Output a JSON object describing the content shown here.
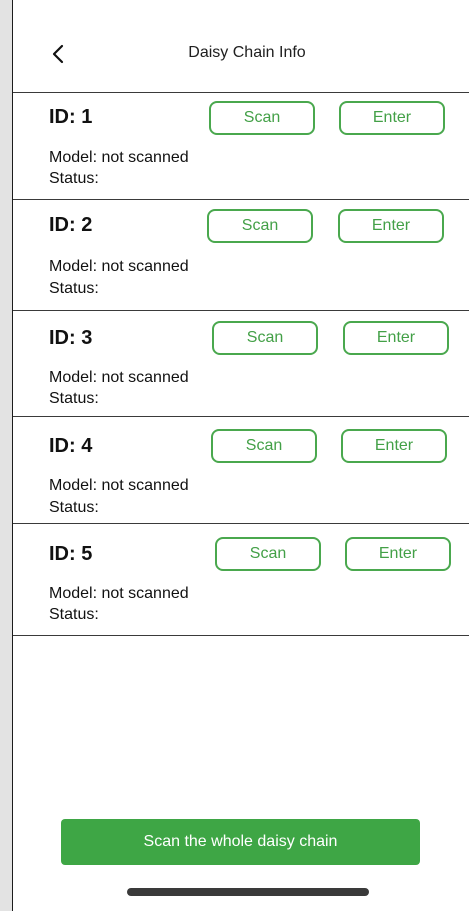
{
  "header": {
    "title": "Daisy Chain Info",
    "back_icon": "chevron-left-icon"
  },
  "devices": [
    {
      "id_label": "ID: 1",
      "scan_label": "Scan",
      "enter_label": "Enter",
      "model": "Model: not scanned",
      "status": "Status:"
    },
    {
      "id_label": "ID: 2",
      "scan_label": "Scan",
      "enter_label": "Enter",
      "model": "Model: not scanned",
      "status": "Status:"
    },
    {
      "id_label": "ID: 3",
      "scan_label": "Scan",
      "enter_label": "Enter",
      "model": "Model: not scanned",
      "status": "Status:"
    },
    {
      "id_label": "ID: 4",
      "scan_label": "Scan",
      "enter_label": "Enter",
      "model": "Model: not scanned",
      "status": "Status:"
    },
    {
      "id_label": "ID: 5",
      "scan_label": "Scan",
      "enter_label": "Enter",
      "model": "Model: not scanned",
      "status": "Status:"
    }
  ],
  "footer": {
    "scan_all_label": "Scan the whole daisy chain"
  },
  "colors": {
    "accent_green": "#3ea645",
    "button_border": "#4aa84e",
    "divider": "#3a3a3a"
  }
}
